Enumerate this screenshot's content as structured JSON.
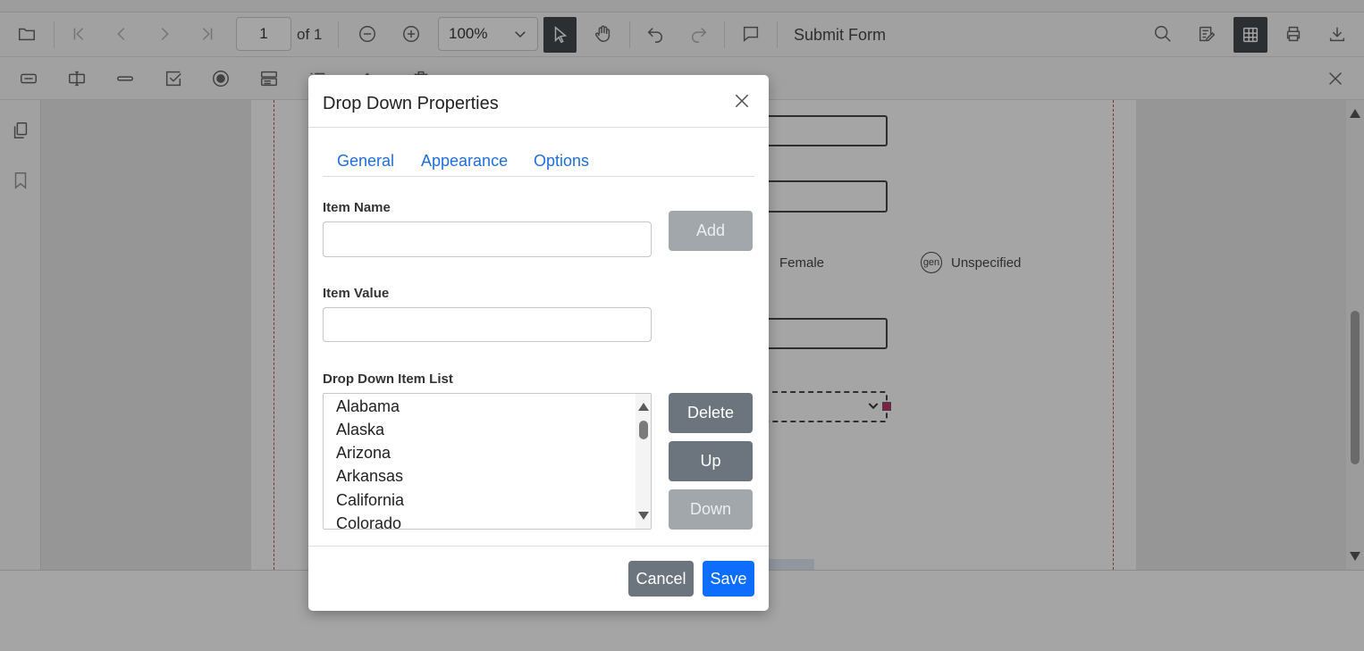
{
  "toolbar": {
    "page_number": "1",
    "page_of": "of 1",
    "zoom": "100%",
    "submit_form": "Submit Form"
  },
  "page_content": {
    "radio_female": "Female",
    "radio_unspecified": "Unspecified",
    "radio_gen_text": "gen"
  },
  "dialog": {
    "title": "Drop Down Properties",
    "tabs": [
      "General",
      "Appearance",
      "Options"
    ],
    "item_name_label": "Item Name",
    "item_name_value": "",
    "item_value_label": "Item Value",
    "item_value_value": "",
    "list_label": "Drop Down Item List",
    "list_items": [
      "Alabama",
      "Alaska",
      "Arizona",
      "Arkansas",
      "California",
      "Colorado"
    ],
    "buttons": {
      "add": "Add",
      "delete": "Delete",
      "up": "Up",
      "down": "Down",
      "cancel": "Cancel",
      "save": "Save"
    }
  },
  "colors": {
    "accent_blue": "#0d6efd",
    "tab_blue": "#1f6fdb",
    "button_gray": "#6c757d",
    "button_disabled": "#a2a7ac",
    "field_marker": "#c2185b"
  }
}
